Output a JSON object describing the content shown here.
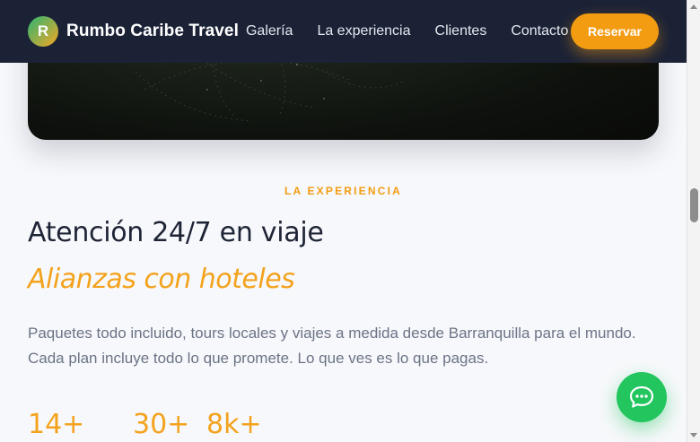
{
  "nav": {
    "logo_letter": "R",
    "brand": "Rumbo Caribe Travel",
    "links": [
      "Galería",
      "La experiencia",
      "Clientes",
      "Contacto"
    ],
    "cta": "Reservar"
  },
  "section": {
    "eyebrow": "LA EXPERIENCIA",
    "title": "Atención 24/7 en viaje",
    "subtitle": "Alianzas con hoteles",
    "description": "Paquetes todo incluido, tours locales y viajes a medida desde Barranquilla para el mundo. Cada plan incluye todo lo que promete. Lo que ves es lo que pagas.",
    "stats": [
      "14+",
      "30+",
      "8k+"
    ]
  },
  "colors": {
    "accent": "#f39c12",
    "nav_bg": "#1b2236",
    "chat": "#22c55e"
  },
  "icons": {
    "chat": "chat-bubble-icon"
  }
}
